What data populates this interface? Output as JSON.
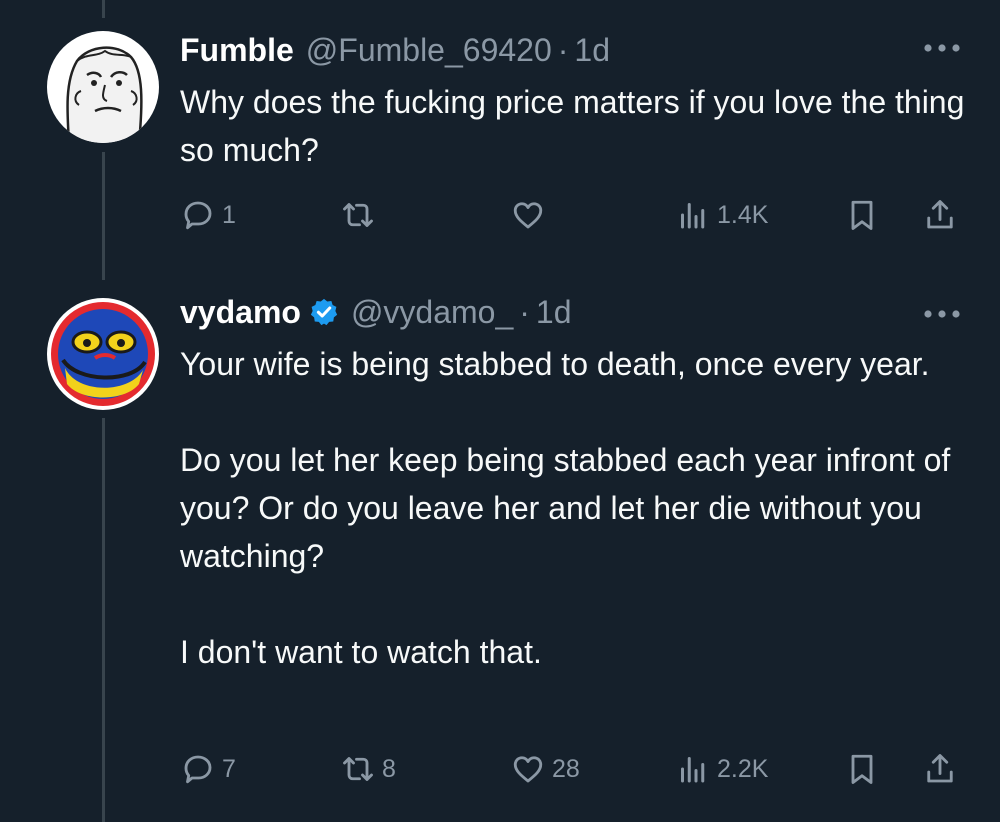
{
  "tweets": [
    {
      "name": "Fumble",
      "handle": "@Fumble_69420",
      "separator": "·",
      "time": "1d",
      "text_lines": [
        "Why does the fucking price matters if you love the thing so much?"
      ],
      "replies": "1",
      "retweets": "",
      "likes": "",
      "views": "1.4K",
      "avatar_icon": "wojak-face-icon"
    },
    {
      "name": "vydamo",
      "verified": true,
      "handle": "@vydamo_",
      "separator": "·",
      "time": "1d",
      "paragraphs": [
        "Your wife is being stabbed to death, once every year.",
        "Do you let her keep being stabbed each year infront of you? Or do you leave her and let her die without you watching?",
        "I don't want to watch that."
      ],
      "replies": "7",
      "retweets": "8",
      "likes": "28",
      "views": "2.2K",
      "avatar_icon": "pepe-frog-icon"
    }
  ],
  "colors": {
    "background": "#15202b",
    "secondary_text": "#8b98a5",
    "verified_blue": "#1d9bf0",
    "thread_line": "#38444d"
  }
}
